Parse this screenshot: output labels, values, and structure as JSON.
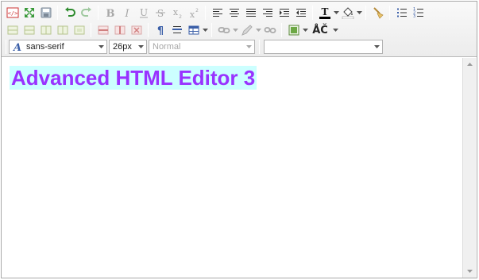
{
  "toolbar": {
    "font_family": {
      "value": "sans-serif"
    },
    "font_size": {
      "value": "26px"
    },
    "format": {
      "value": "Normal"
    },
    "style": {
      "value": ""
    },
    "special_chars_label": "ÅČ"
  },
  "content": {
    "heading_text": "Advanced HTML Editor 3",
    "heading_color": "#9933ff",
    "heading_background": "#ccffff"
  }
}
